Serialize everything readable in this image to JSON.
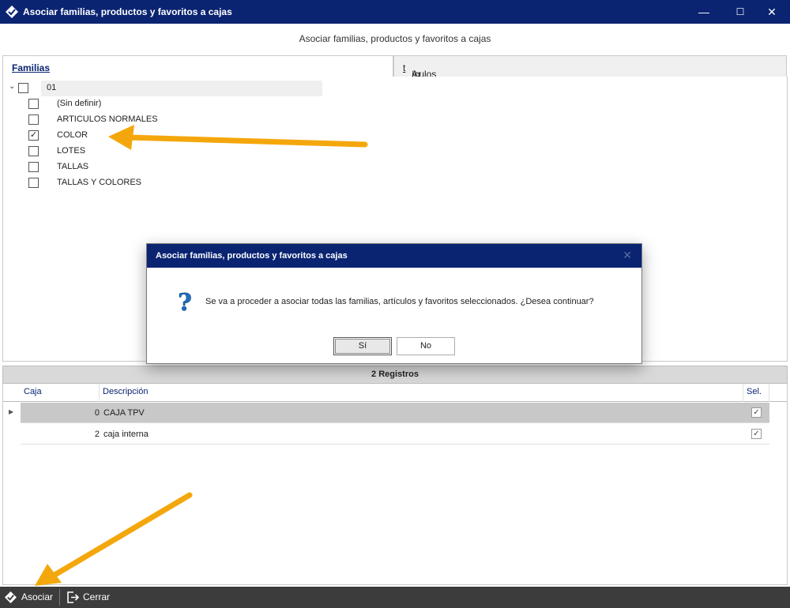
{
  "window": {
    "title": "Asociar familias, productos y favoritos a cajas",
    "minimize": "—",
    "maximize": "☐",
    "close": "✕"
  },
  "subtitle": "Asociar familias, productos y favoritos a cajas",
  "tabs": {
    "familias": "Familias",
    "articulos_prefix": "Ar",
    "articulos_underlined": "t",
    "articulos_suffix": "ículos"
  },
  "tree": {
    "root_label": "01",
    "items": [
      {
        "label": "(Sin definir)",
        "checked": false
      },
      {
        "label": "ARTICULOS NORMALES",
        "checked": false
      },
      {
        "label": "COLOR",
        "checked": true
      },
      {
        "label": "LOTES",
        "checked": false
      },
      {
        "label": "TALLAS",
        "checked": false
      },
      {
        "label": "TALLAS Y COLORES",
        "checked": false
      }
    ]
  },
  "grid": {
    "header_bar": "2 Registros",
    "columns": {
      "caja": "Caja",
      "descripcion": "Descripción",
      "sel": "Sel."
    },
    "rows": [
      {
        "caja": "0",
        "descripcion": "CAJA TPV",
        "sel": true
      },
      {
        "caja": "2",
        "descripcion": "caja interna",
        "sel": true
      }
    ]
  },
  "statusbar": {
    "asociar": "Asociar",
    "cerrar": "Cerrar"
  },
  "dialog": {
    "title": "Asociar familias, productos y favoritos a cajas",
    "close": "✕",
    "message": "Se va a proceder a asociar todas las familias, artículos y favoritos seleccionados. ¿Desea continuar?",
    "yes": "Sí",
    "no": "No"
  },
  "colors": {
    "titlebar": "#0a2472",
    "statusbar": "#3c3c3c",
    "annotation_arrow": "#f4a70c",
    "question_icon": "#3a8fd8"
  }
}
